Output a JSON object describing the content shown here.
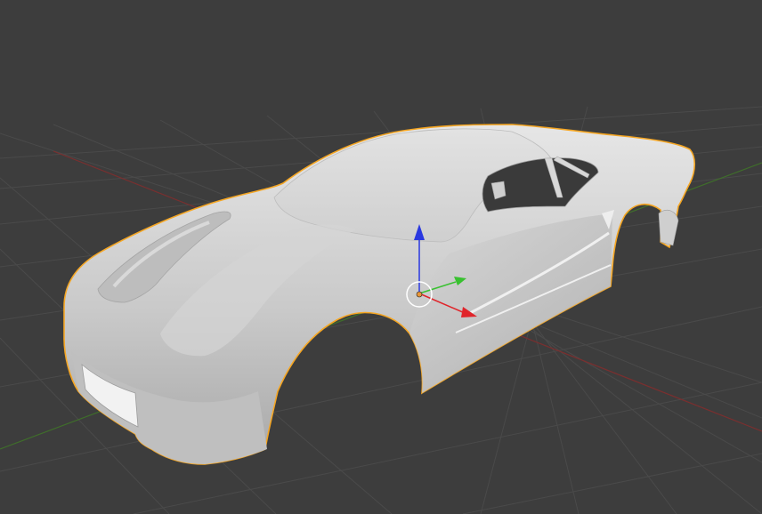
{
  "viewport": {
    "background": "#3d3d3d",
    "grid_color": "#4a4a4a",
    "x_axis_color": "#7a2f2f",
    "y_axis_color": "#3f6f2a"
  },
  "scene_object": {
    "name": "car-body",
    "selected": true,
    "outline_color": "#f5a623",
    "body_color": "#c9c9c9"
  },
  "gizmo": {
    "type": "move",
    "x_color": "#e0242a",
    "y_color": "#39c130",
    "z_color": "#2a38e0",
    "origin_color": "#ffffff",
    "pivot_color": "#e8963a"
  }
}
